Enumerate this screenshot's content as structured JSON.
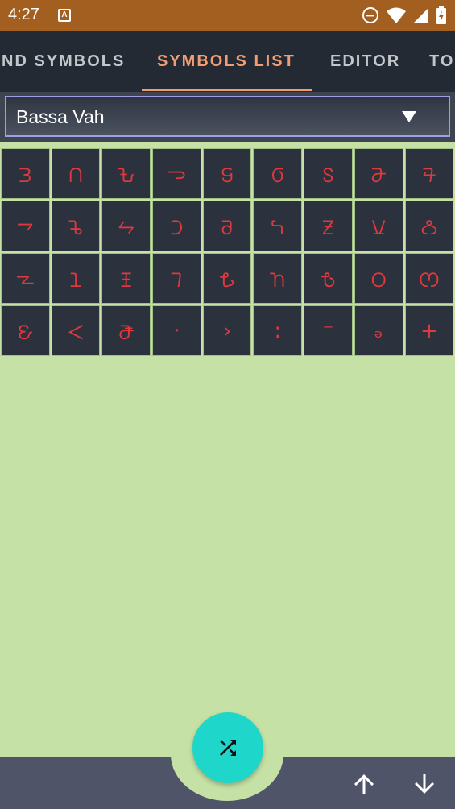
{
  "status_bar": {
    "time": "4:27",
    "notification_icon": "a-icon",
    "icons": [
      "do-not-disturb-icon",
      "wifi-icon",
      "signal-icon",
      "battery-charging-icon"
    ]
  },
  "tabs": [
    {
      "label": "ND SYMBOLS",
      "active": false
    },
    {
      "label": "SYMBOLS LIST",
      "active": true
    },
    {
      "label": "EDITOR",
      "active": false
    },
    {
      "label": "TO",
      "active": false
    }
  ],
  "dropdown": {
    "selected": "Bassa Vah"
  },
  "symbols": [
    "𖫐",
    "𖫑",
    "𖫒",
    "𖫓",
    "𖫔",
    "𖫕",
    "𖫖",
    "𖫗",
    "𖫘",
    "𖫙",
    "𖫚",
    "𖫛",
    "𖫜",
    "𖫝",
    "𖫞",
    "𖫟",
    "𖫠",
    "𖫡",
    "𖫢",
    "𖫣",
    "𖫤",
    "𖫥",
    "𖫦",
    "𖫧",
    "𖫨",
    "𖫩",
    "𖫪",
    "𖫫",
    "𖫬",
    "𖫭",
    "·",
    "›",
    "꞉",
    "⁻",
    "ₔ",
    "+"
  ],
  "fab": {
    "icon": "shuffle-icon"
  },
  "bottom_nav": {
    "up_icon": "arrow-up-icon",
    "down_icon": "arrow-down-icon"
  },
  "colors": {
    "status_bar": "#a25f1f",
    "tab_bar": "#232a34",
    "active_tab": "#f29c72",
    "background": "#c6e1a5",
    "cell": "#2c323d",
    "symbol": "#e0383d",
    "fab": "#1ed6c9",
    "bottom_bar": "#4f5468"
  }
}
